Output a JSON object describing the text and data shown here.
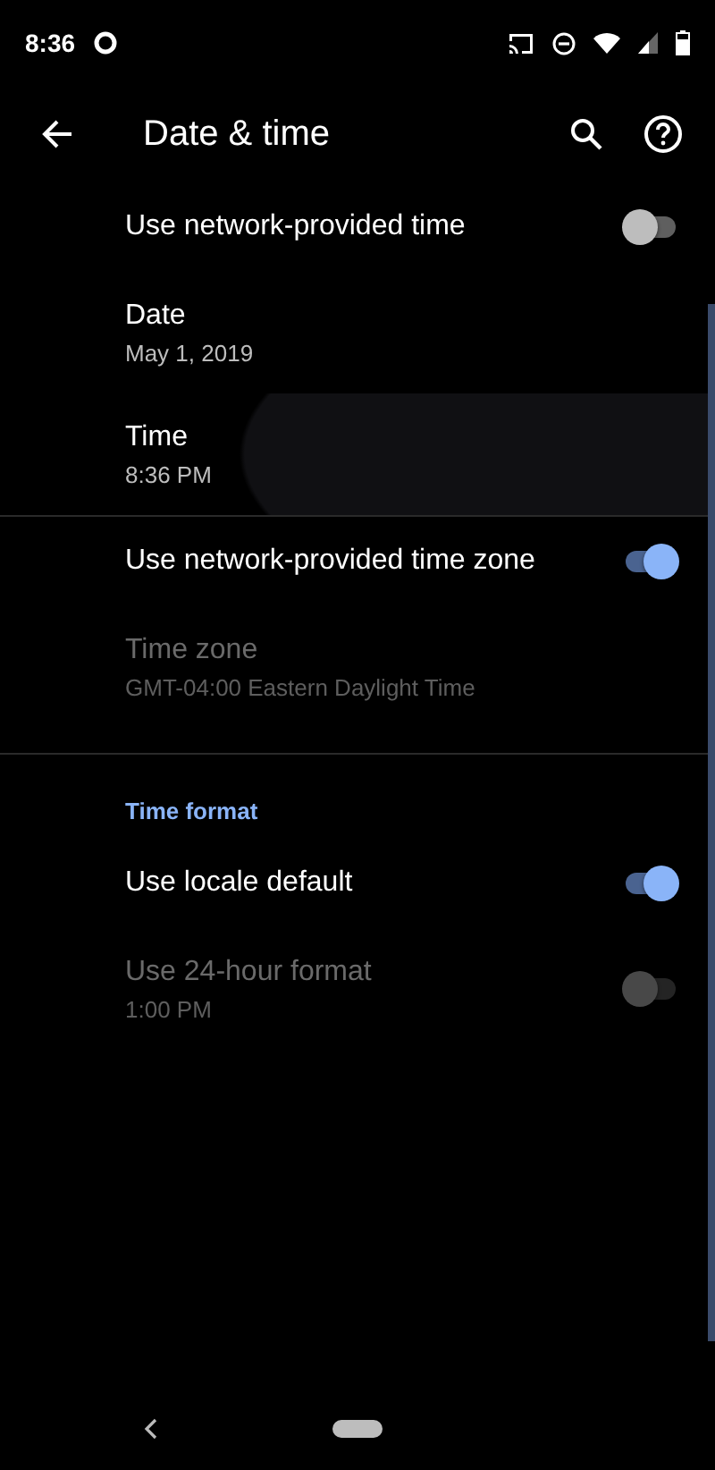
{
  "status_bar": {
    "time": "8:36"
  },
  "toolbar": {
    "title": "Date & time"
  },
  "sections": [
    {
      "items": [
        {
          "kind": "switch",
          "title": "Use network-provided time",
          "on": false,
          "disabled": false
        },
        {
          "kind": "text",
          "title": "Date",
          "summary": "May 1, 2019",
          "disabled": false,
          "pressed": false
        },
        {
          "kind": "text",
          "title": "Time",
          "summary": "8:36 PM",
          "disabled": false,
          "pressed": true
        }
      ]
    },
    {
      "items": [
        {
          "kind": "switch",
          "title": "Use network-provided time zone",
          "on": true,
          "disabled": false
        },
        {
          "kind": "text",
          "title": "Time zone",
          "summary": "GMT-04:00 Eastern Daylight Time",
          "disabled": true,
          "pressed": false
        }
      ]
    },
    {
      "header": "Time format",
      "items": [
        {
          "kind": "switch",
          "title": "Use locale default",
          "on": true,
          "disabled": false
        },
        {
          "kind": "switch",
          "title": "Use 24-hour format",
          "summary": "1:00 PM",
          "on": false,
          "disabled": true
        }
      ]
    }
  ]
}
